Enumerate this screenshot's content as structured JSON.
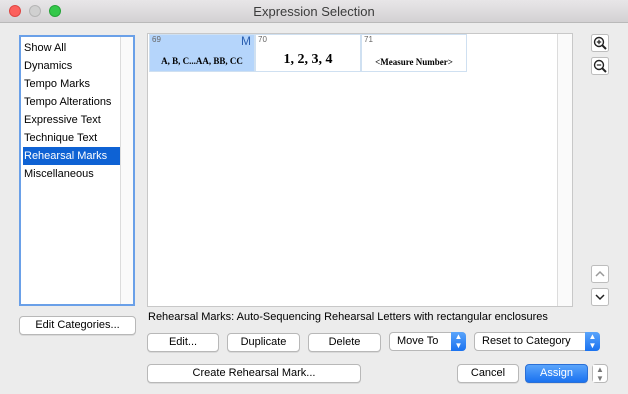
{
  "window": {
    "title": "Expression Selection"
  },
  "categories": {
    "items": [
      "Show All",
      "Dynamics",
      "Tempo Marks",
      "Tempo Alterations",
      "Expressive Text",
      "Technique Text",
      "Rehearsal Marks",
      "Miscellaneous"
    ],
    "selected": "Rehearsal Marks",
    "edit_label": "Edit Categories..."
  },
  "expressions": [
    {
      "number": "69",
      "letter": "M",
      "text": "A, B, C...AA, BB, CC",
      "selected": true
    },
    {
      "number": "70",
      "letter": "",
      "text": "1, 2, 3, 4",
      "selected": false
    },
    {
      "number": "71",
      "letter": "",
      "text": "<Measure Number>",
      "selected": false
    }
  ],
  "description": "Rehearsal Marks: Auto-Sequencing Rehearsal Letters with rectangular enclosures",
  "buttons": {
    "edit": "Edit...",
    "duplicate": "Duplicate",
    "delete": "Delete",
    "move_to": "Move To",
    "reset": "Reset to Category",
    "create": "Create Rehearsal Mark...",
    "cancel": "Cancel",
    "assign": "Assign"
  },
  "icons": {
    "zoom_in": "zoom-in-icon",
    "zoom_out": "zoom-out-icon",
    "scroll_up": "chevron-up-icon",
    "scroll_down": "chevron-down-icon"
  },
  "colors": {
    "accent": "#1a72f0",
    "selection": "#0e62d4",
    "cell_selection": "#b5d5fb"
  }
}
